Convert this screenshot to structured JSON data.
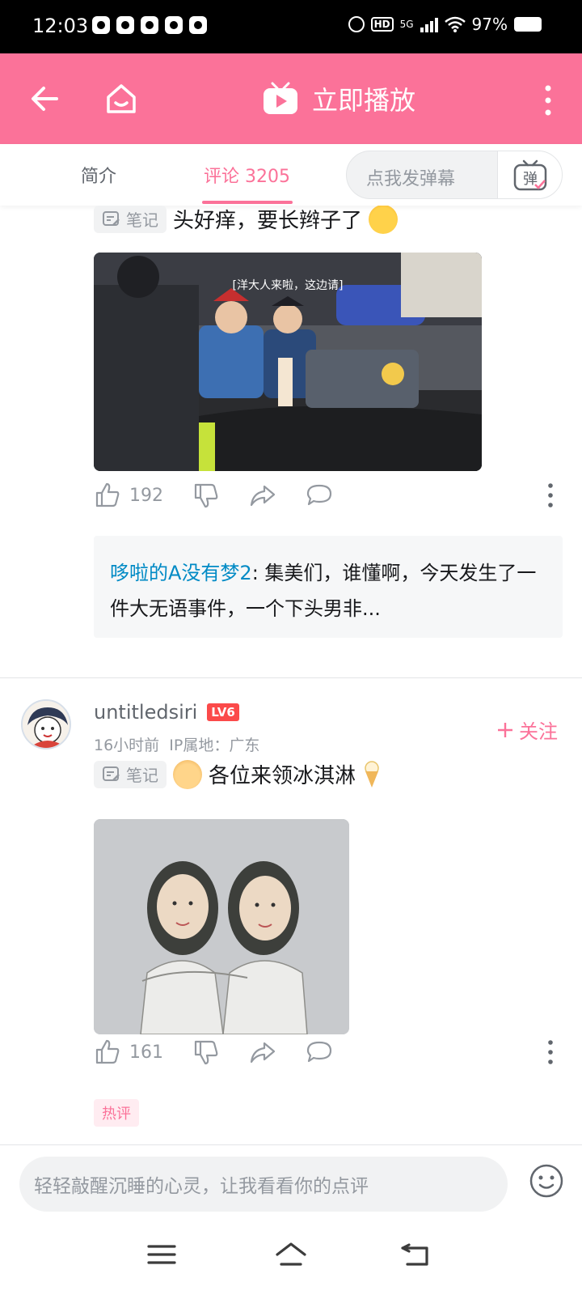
{
  "status_bar": {
    "time": "12:03",
    "network": "5G",
    "hd": "HD",
    "battery": "97%"
  },
  "header": {
    "play_label": "立即播放"
  },
  "tabs": {
    "intro": "简介",
    "comments": "评论 3205",
    "danmaku_placeholder": "点我发弹幕",
    "danmaku_toggle": "弹"
  },
  "comment1": {
    "note_tag": "笔记",
    "text": "头好痒，要长辫子了",
    "image_caption": "[洋大人来啦，这边请]",
    "like_count": "192",
    "reply_user": "哆啦的A没有梦2",
    "reply_text": ": 集美们，谁懂啊，今天发生了一件大无语事件，一个下头男非..."
  },
  "comment2": {
    "username": "untitledsiri",
    "level": "LV6",
    "time": "16小时前",
    "ip": "IP属地：广东",
    "follow": "关注",
    "note_tag": "笔记",
    "text": "各位来领冰淇淋",
    "like_count": "161",
    "hot_tag": "热评"
  },
  "bottom_bar": {
    "placeholder": "轻轻敲醒沉睡的心灵，让我看看你的点评"
  },
  "colors": {
    "brand_pink": "#fb7299",
    "link_blue": "#008ac5",
    "level_red": "#fb4a4a"
  }
}
